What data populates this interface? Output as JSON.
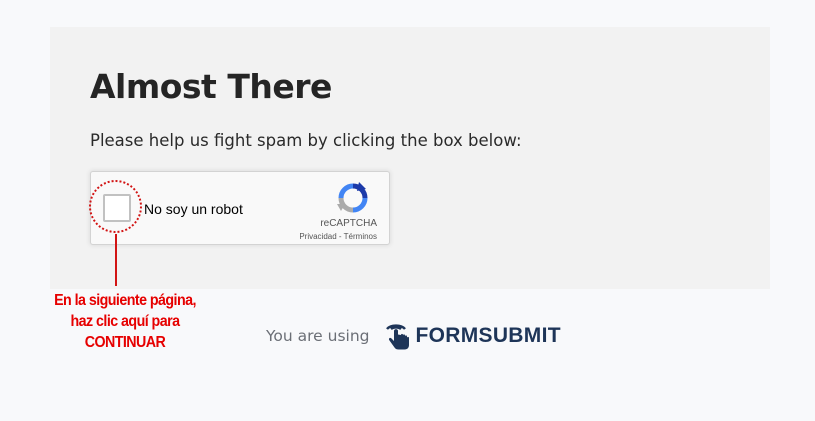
{
  "card": {
    "title": "Almost There",
    "description": "Please help us fight spam by clicking the box below:"
  },
  "recaptcha": {
    "checkbox_label": "No soy un robot",
    "brand": "reCAPTCHA",
    "privacy": "Privacidad",
    "separator": " - ",
    "terms": "Términos",
    "logo_icon": "recaptcha-logo-icon",
    "checked": false
  },
  "annotation": {
    "line1": "En la siguiente página,",
    "line2": "haz clic aquí para",
    "line3": "CONTINUAR",
    "color": "#e60000"
  },
  "footer": {
    "using_text": "You are using",
    "brand": "FORMSUBMIT",
    "brand_icon": "pointer-hand-icon"
  },
  "colors": {
    "page_bg": "#f8f9fb",
    "card_bg": "#f2f2f2",
    "brand_blue": "#1e3558",
    "annotation_red": "#d21414"
  }
}
